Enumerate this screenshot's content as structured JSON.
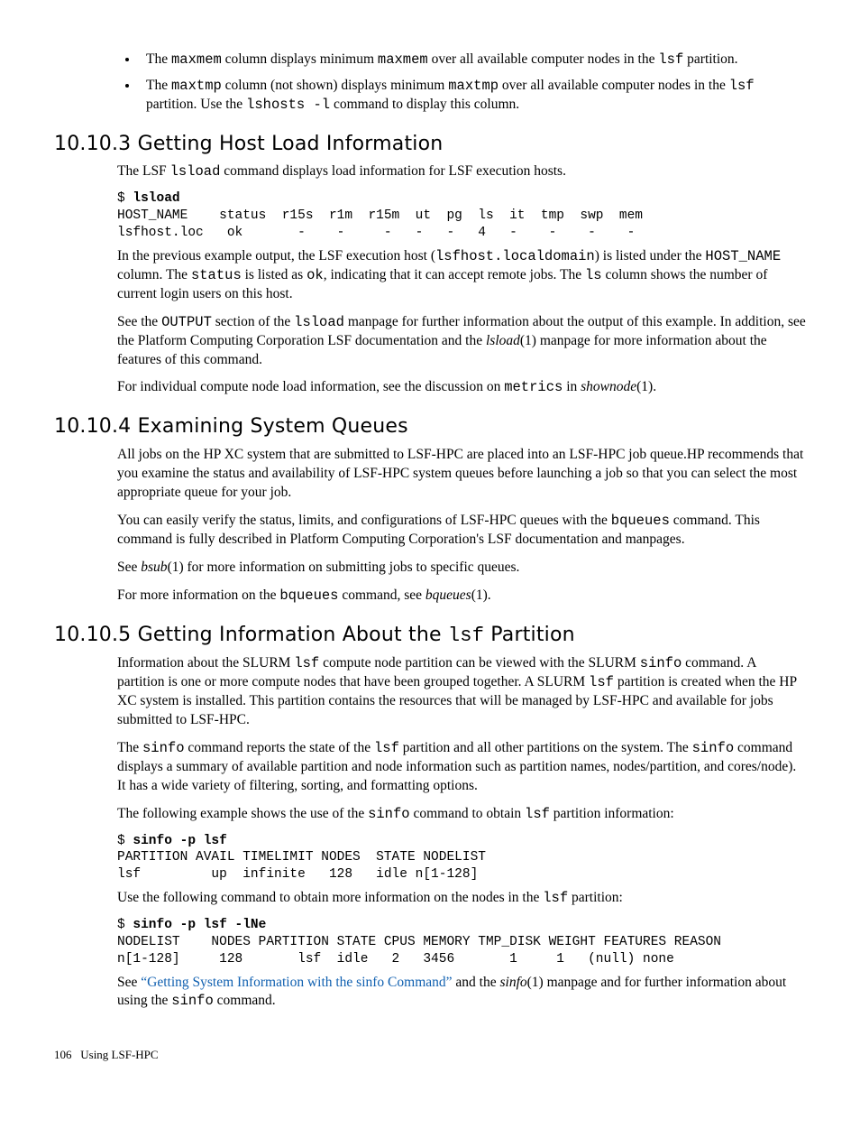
{
  "bullets": {
    "b1": {
      "pre1": "The ",
      "code1": "maxmem",
      "mid1": " column displays minimum ",
      "code2": "maxmem",
      "mid2": " over all available computer nodes in the ",
      "code3": "lsf",
      "post": " partition."
    },
    "b2": {
      "pre1": "The ",
      "code1": "maxtmp",
      "mid1": " column (not shown) displays minimum ",
      "code2": "maxtmp",
      "mid2": " over all available computer nodes in the ",
      "code3": "lsf",
      "mid3": " partition. Use the ",
      "code4": "lshosts -l",
      "post": " command to display this column."
    }
  },
  "sec10103": {
    "heading": "10.10.3 Getting Host Load Information",
    "p1": {
      "pre": "The LSF ",
      "code": "lsload",
      "post": " command displays load information for LSF execution hosts."
    },
    "code1": "$ lsload\nHOST_NAME    status  r15s  r1m  r15m  ut  pg  ls  it  tmp  swp  mem\nlsfhost.loc   ok       -    -     -   -   -   4   -    -    -    -",
    "code1_prompt": "$ ",
    "code1_cmd": "lsload",
    "code1_rest": "\nHOST_NAME    status  r15s  r1m  r15m  ut  pg  ls  it  tmp  swp  mem\nlsfhost.loc   ok       -    -     -   -   -   4   -    -    -    -",
    "p2": {
      "pre": "In the previous example output, the LSF execution host (",
      "c1": "lsfhost.localdomain",
      "m1": ") is listed under the ",
      "c2": "HOST_NAME",
      "m2": " column. The ",
      "c3": "status",
      "m3": " is listed as ",
      "c4": "ok",
      "m4": ", indicating that it can accept remote jobs. The ",
      "c5": "ls",
      "post": " column shows the number of current login users on this host."
    },
    "p3": {
      "pre": "See the ",
      "c1": "OUTPUT",
      "m1": " section of the ",
      "c2": "lsload",
      "m2": " manpage for further information about the output of this example. In addition, see the Platform Computing Corporation LSF documentation and the ",
      "i1": "lsload",
      "post": "(1) manpage for more information about the features of this command."
    },
    "p4": {
      "pre": "For individual compute node load information, see the discussion on ",
      "c1": "metrics",
      "m1": " in ",
      "i1": "shownode",
      "post": "(1)."
    }
  },
  "sec10104": {
    "heading": "10.10.4 Examining System Queues",
    "p1": "All jobs on the HP XC system that are submitted to LSF-HPC are placed into an LSF-HPC job queue.HP recommends that you examine the status and availability of LSF-HPC system queues before launching a job so that you can select the most appropriate queue for your job.",
    "p2": {
      "pre": "You can easily verify the status, limits, and configurations of LSF-HPC queues with the ",
      "c1": "bqueues",
      "post": " command. This command is fully described in Platform Computing Corporation's LSF documentation and manpages."
    },
    "p3": {
      "pre": "See ",
      "i1": "bsub",
      "post": "(1) for more information on submitting jobs to specific queues."
    },
    "p4": {
      "pre": "For more information on the ",
      "c1": "bqueues",
      "m1": " command, see ",
      "i1": "bqueues",
      "post": "(1)."
    }
  },
  "sec10105": {
    "heading_pre": "10.10.5 Getting Information About the ",
    "heading_code": "lsf",
    "heading_post": " Partition",
    "p1": {
      "pre": "Information about the SLURM ",
      "c1": "lsf",
      "m1": " compute node partition can be viewed with the SLURM ",
      "c2": "sinfo",
      "m2": " command. A partition is one or more compute nodes that have been grouped together. A SLURM ",
      "c3": "lsf",
      "post": " partition is created when the HP XC system is installed. This partition contains the resources that will be managed by LSF-HPC and available for jobs submitted to LSF-HPC."
    },
    "p2": {
      "pre": "The ",
      "c1": "sinfo",
      "m1": " command reports the state of the ",
      "c2": "lsf",
      "m2": " partition and all other partitions on the system. The ",
      "c3": "sinfo",
      "post": " command displays a summary of available partition and node information such as partition names, nodes/partition, and cores/node). It has a wide variety of filtering, sorting, and formatting options."
    },
    "p3": {
      "pre": "The following example shows the use of the ",
      "c1": "sinfo",
      "m1": " command to obtain ",
      "c2": "lsf",
      "post": " partition information:"
    },
    "code1_prompt": "$ ",
    "code1_cmd": "sinfo -p lsf",
    "code1_rest": "\nPARTITION AVAIL TIMELIMIT NODES  STATE NODELIST\nlsf         up  infinite   128   idle n[1-128]",
    "p4": {
      "pre": "Use the following command to obtain more information on the nodes in the ",
      "c1": "lsf",
      "post": " partition:"
    },
    "code2_prompt": "$ ",
    "code2_cmd": "sinfo -p lsf -lNe",
    "code2_rest": "\nNODELIST    NODES PARTITION STATE CPUS MEMORY TMP_DISK WEIGHT FEATURES REASON\nn[1-128]     128       lsf  idle   2   3456       1     1   (null) none",
    "p5": {
      "pre": "See ",
      "link": "“Getting System Information with the sinfo Command”",
      "m1": " and the ",
      "i1": "sinfo",
      "m2": "(1) manpage and for further information about using the ",
      "c1": "sinfo",
      "post": " command."
    }
  },
  "footer": {
    "page": "106",
    "label": "Using LSF-HPC"
  }
}
